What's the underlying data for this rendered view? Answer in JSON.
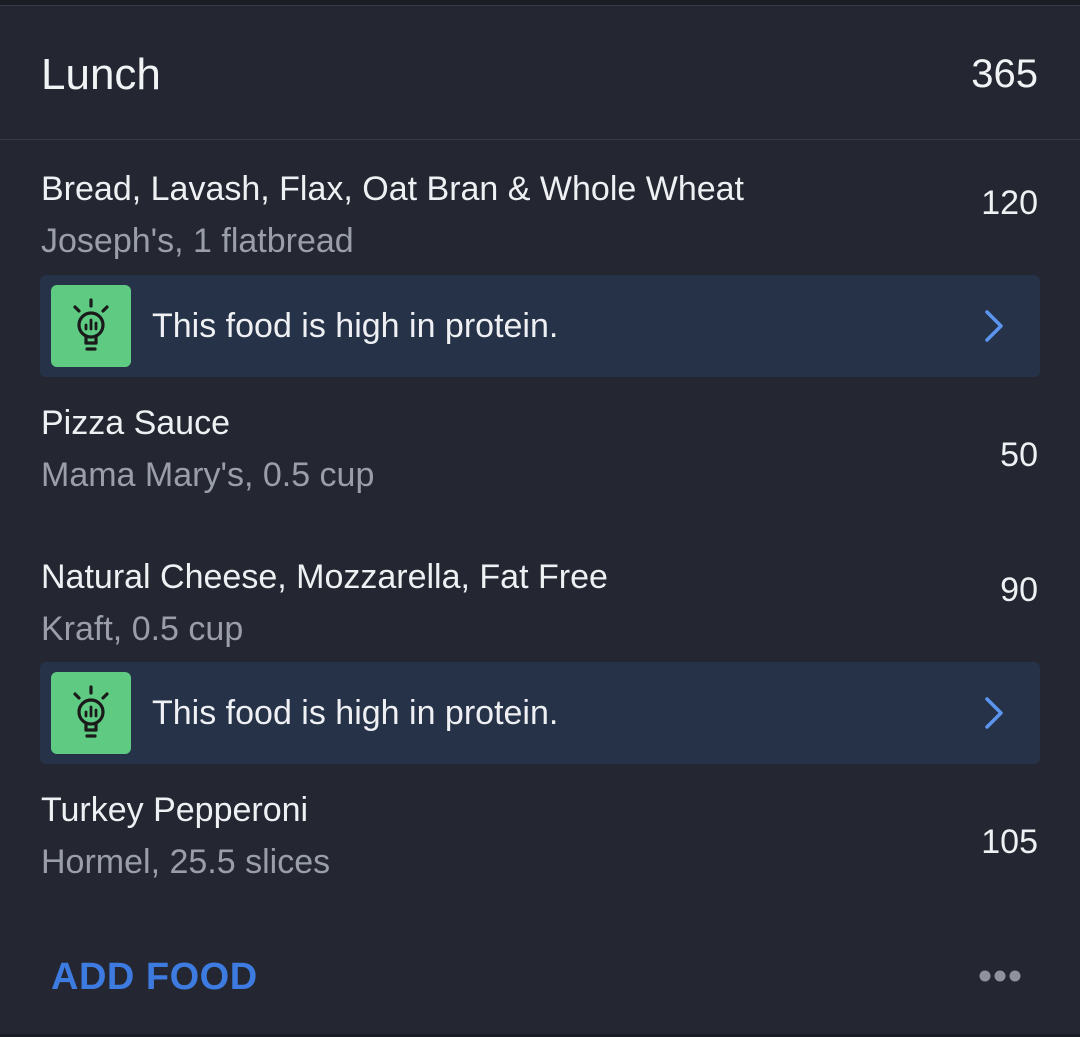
{
  "meal": {
    "title": "Lunch",
    "total_calories": "365"
  },
  "items": [
    {
      "name": "Bread, Lavash, Flax, Oat Bran & Whole Wheat",
      "detail": "Joseph's, 1 flatbread",
      "calories": "120",
      "tip": {
        "text": "This food is high in protein.",
        "icon": "lightbulb-icon"
      }
    },
    {
      "name": "Pizza Sauce",
      "detail": "Mama Mary's, 0.5 cup",
      "calories": "50"
    },
    {
      "name": "Natural Cheese, Mozzarella, Fat Free",
      "detail": "Kraft, 0.5 cup",
      "calories": "90",
      "tip": {
        "text": "This food is high in protein.",
        "icon": "lightbulb-icon"
      }
    },
    {
      "name": "Turkey Pepperoni",
      "detail": "Hormel, 25.5 slices",
      "calories": "105"
    }
  ],
  "footer": {
    "add_food_label": "ADD FOOD",
    "more_icon": "more-horizontal-icon"
  },
  "colors": {
    "background": "#242731",
    "tip_background": "#263248",
    "tip_icon_background": "#5fcb82",
    "accent_blue": "#3d7be0",
    "chevron_blue": "#5b95f0",
    "secondary_text": "#9a9ea8"
  }
}
